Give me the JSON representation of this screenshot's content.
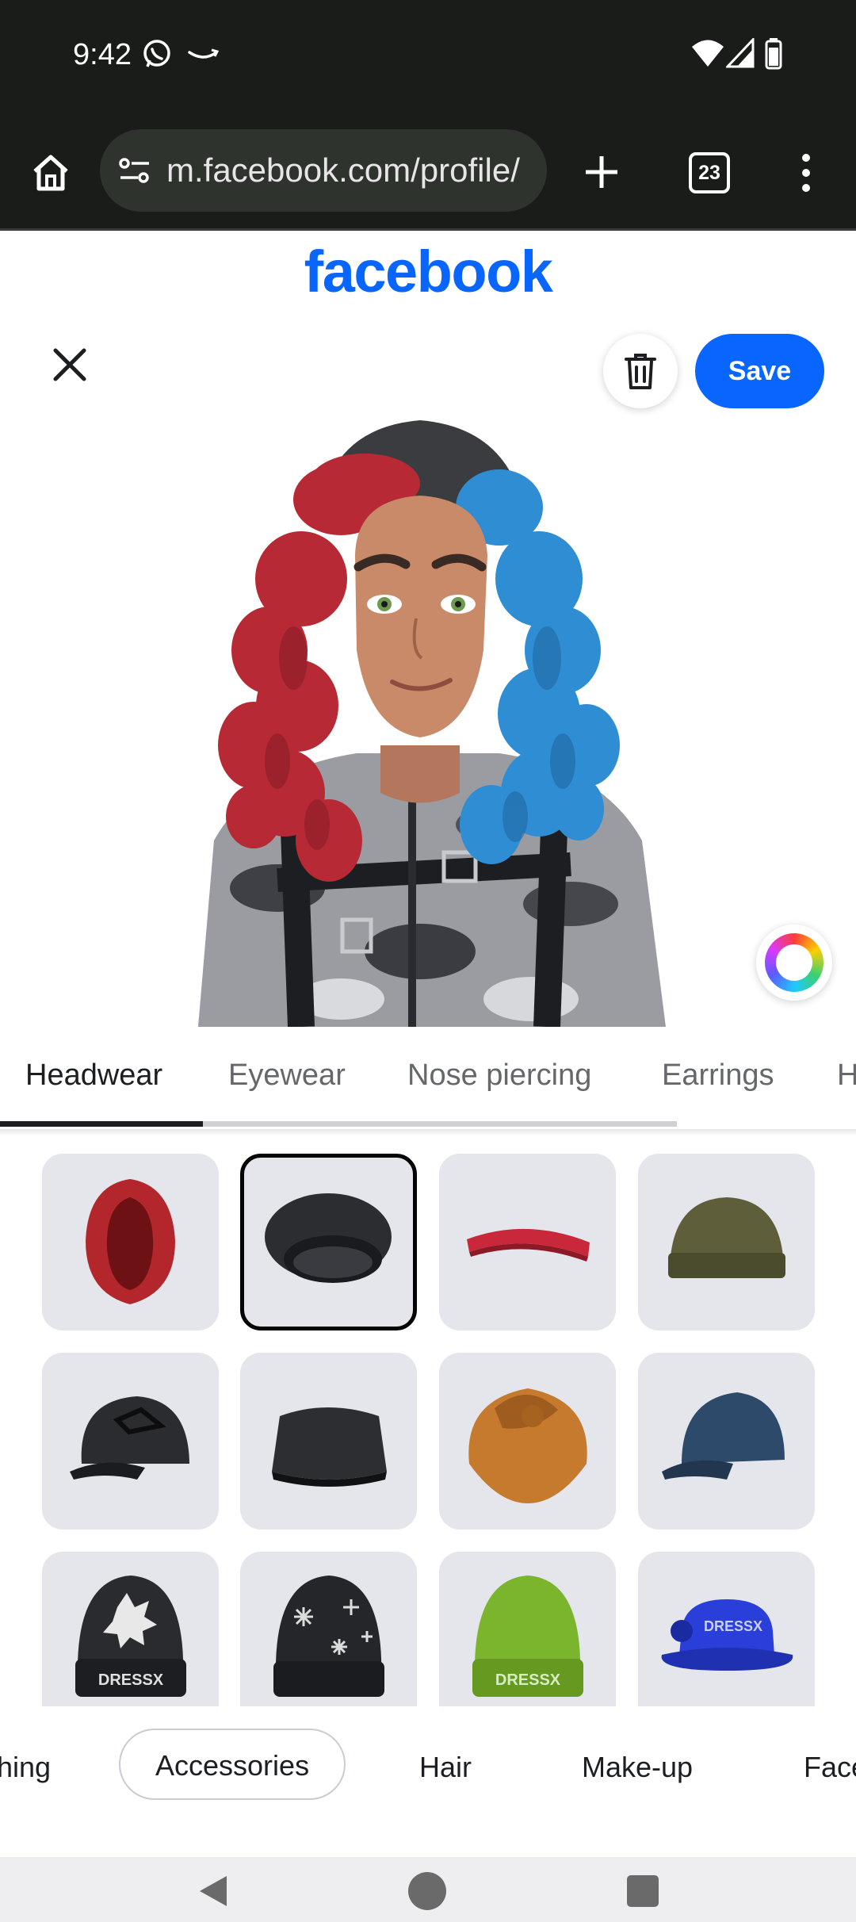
{
  "status_bar": {
    "time": "9:42",
    "icons": [
      "whatsapp-icon",
      "amazon-icon",
      "wifi-icon",
      "signal-icon",
      "battery-icon"
    ]
  },
  "browser": {
    "url": "m.facebook.com/profile/",
    "tab_count": "23",
    "icons": [
      "home-icon",
      "site-info-icon",
      "new-tab-icon",
      "tab-switcher-icon",
      "menu-icon"
    ]
  },
  "header": {
    "logo": "facebook",
    "save_label": "Save"
  },
  "categories": {
    "tabs": [
      {
        "label": "Headwear",
        "active": true
      },
      {
        "label": "Eyewear",
        "active": false
      },
      {
        "label": "Nose piercing",
        "active": false
      },
      {
        "label": "Earrings",
        "active": false
      },
      {
        "label": "H",
        "active": false
      }
    ]
  },
  "items": [
    {
      "name": "red-hood-item",
      "selected": false,
      "color": "#b3262c",
      "badge": ""
    },
    {
      "name": "black-beanie-item",
      "selected": true,
      "color": "#2c2d31",
      "badge": ""
    },
    {
      "name": "red-headband-item",
      "selected": false,
      "color": "#c8283a",
      "badge": ""
    },
    {
      "name": "olive-beanie-item",
      "selected": false,
      "color": "#5e5e3a",
      "badge": ""
    },
    {
      "name": "black-cap-item",
      "selected": false,
      "color": "#2b2c30",
      "badge": ""
    },
    {
      "name": "black-pillbox-hat-item",
      "selected": false,
      "color": "#2d2e32",
      "badge": ""
    },
    {
      "name": "orange-turban-item",
      "selected": false,
      "color": "#c57a2e",
      "badge": ""
    },
    {
      "name": "blue-cap-item",
      "selected": false,
      "color": "#2e4a6b",
      "badge": ""
    },
    {
      "name": "dressx-holly-beanie-item",
      "selected": false,
      "color": "#2a2b2f",
      "badge": "DRESSX"
    },
    {
      "name": "snowflake-beanie-item",
      "selected": false,
      "color": "#25262a",
      "badge": ""
    },
    {
      "name": "green-dressx-beanie-item",
      "selected": false,
      "color": "#7bb52d",
      "badge": "DRESSX"
    },
    {
      "name": "blue-dressx-bucket-hat-item",
      "selected": false,
      "color": "#2a3fd9",
      "badge": "DRESSX"
    }
  ],
  "sections": {
    "tabs": [
      {
        "label": "hing",
        "active": false
      },
      {
        "label": "Accessories",
        "active": true
      },
      {
        "label": "Hair",
        "active": false
      },
      {
        "label": "Make-up",
        "active": false
      },
      {
        "label": "Face",
        "active": false
      }
    ]
  },
  "colors": {
    "brand": "#0866ff",
    "status_bar_bg": "#1a1c1a",
    "tile_bg": "#e4e6eb"
  }
}
